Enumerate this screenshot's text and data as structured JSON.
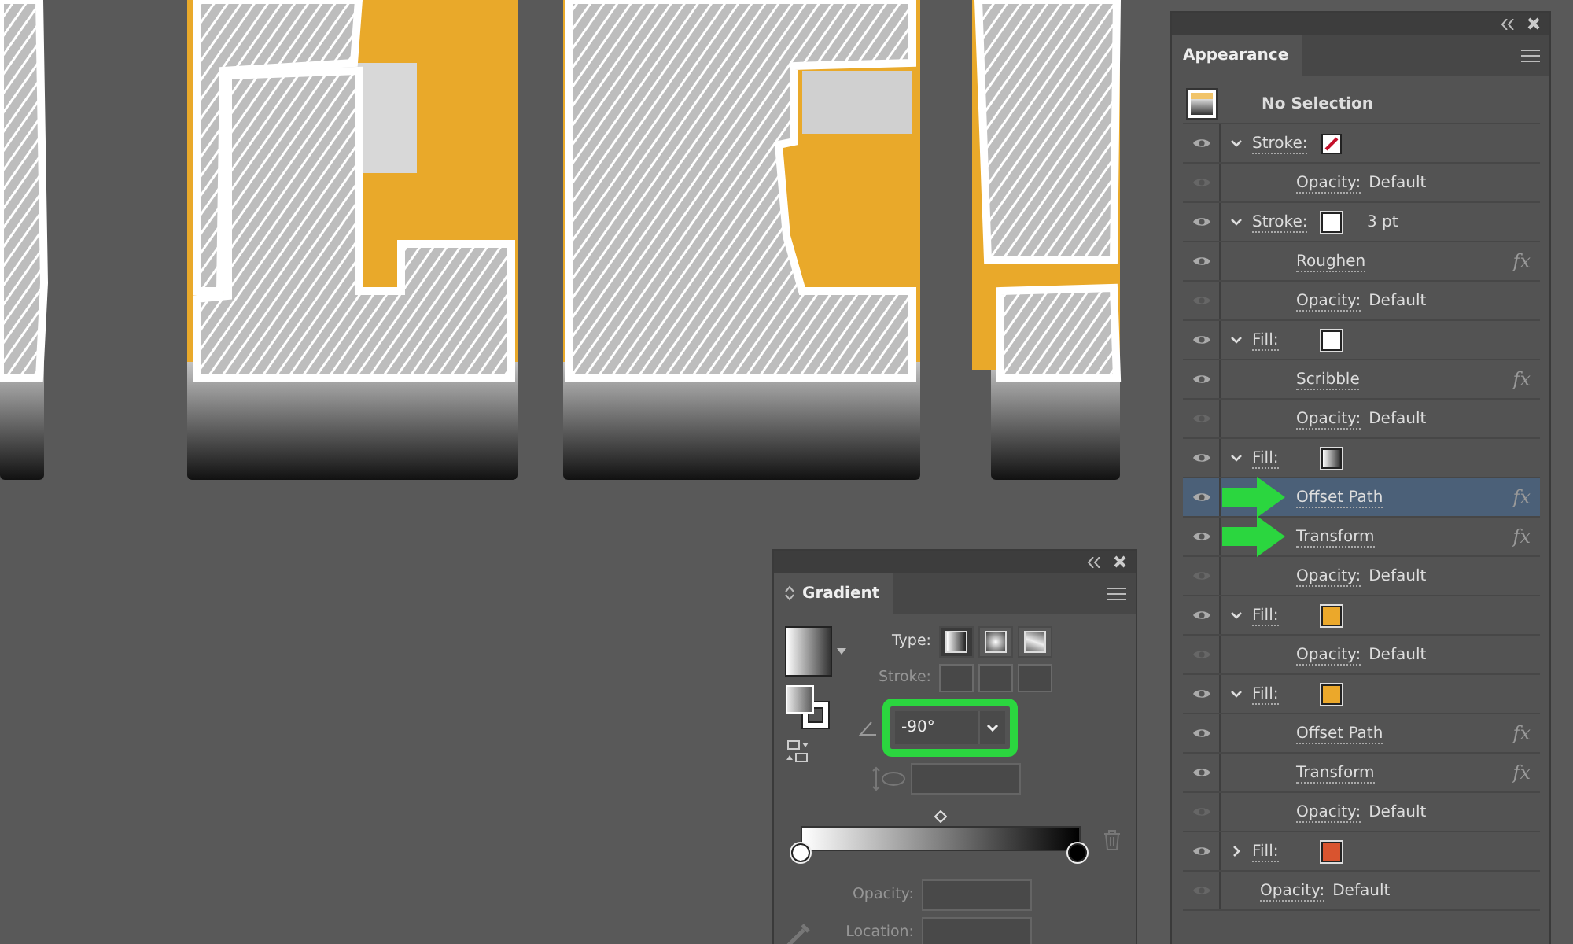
{
  "appearance": {
    "title": "Appearance",
    "header": "No Selection",
    "items": [
      {
        "kind": "stroke",
        "label": "Stroke:",
        "swatch": {
          "kind": "none"
        },
        "expanded": true,
        "children": [
          {
            "kind": "opacity",
            "label": "Opacity:",
            "value": "Default"
          }
        ]
      },
      {
        "kind": "stroke",
        "label": "Stroke:",
        "swatch": {
          "kind": "solid",
          "color": "#ffffff"
        },
        "value": "3 pt",
        "expanded": true,
        "children": [
          {
            "kind": "effect",
            "label": "Roughen",
            "badge": "fx",
            "selected": false,
            "arrow": false
          },
          {
            "kind": "opacity",
            "label": "Opacity:",
            "value": "Default"
          }
        ]
      },
      {
        "kind": "fill",
        "label": "Fill:",
        "swatch": {
          "kind": "solid",
          "color": "#ffffff"
        },
        "expanded": true,
        "children": [
          {
            "kind": "effect",
            "label": "Scribble",
            "badge": "fx",
            "selected": false,
            "arrow": false
          },
          {
            "kind": "opacity",
            "label": "Opacity:",
            "value": "Default"
          }
        ]
      },
      {
        "kind": "fill",
        "label": "Fill:",
        "swatch": {
          "kind": "gradient"
        },
        "expanded": true,
        "children": [
          {
            "kind": "effect",
            "label": "Offset Path",
            "badge": "fx",
            "selected": true,
            "arrow": true
          },
          {
            "kind": "effect",
            "label": "Transform",
            "badge": "fx",
            "selected": false,
            "arrow": true
          },
          {
            "kind": "opacity",
            "label": "Opacity:",
            "value": "Default"
          }
        ]
      },
      {
        "kind": "fill",
        "label": "Fill:",
        "swatch": {
          "kind": "solid",
          "color": "#eba82b"
        },
        "expanded": true,
        "children": [
          {
            "kind": "opacity",
            "label": "Opacity:",
            "value": "Default"
          }
        ]
      },
      {
        "kind": "fill",
        "label": "Fill:",
        "swatch": {
          "kind": "solid",
          "color": "#eba82b"
        },
        "expanded": true,
        "children": [
          {
            "kind": "effect",
            "label": "Offset Path",
            "badge": "fx",
            "selected": false,
            "arrow": false
          },
          {
            "kind": "effect",
            "label": "Transform",
            "badge": "fx",
            "selected": false,
            "arrow": false
          },
          {
            "kind": "opacity",
            "label": "Opacity:",
            "value": "Default"
          }
        ]
      },
      {
        "kind": "fill",
        "label": "Fill:",
        "swatch": {
          "kind": "solid",
          "color": "#d9542f"
        },
        "expanded": false
      },
      {
        "kind": "opacity",
        "label": "Opacity:",
        "value": "Default"
      }
    ]
  },
  "gradient": {
    "title": "Gradient",
    "type_label": "Type:",
    "types": [
      {
        "kind": "linear",
        "selected": true
      },
      {
        "kind": "radial",
        "selected": false
      },
      {
        "kind": "freeform",
        "selected": false
      }
    ],
    "stroke_label": "Stroke:",
    "angle": {
      "value": "-90°",
      "highlighted": true
    },
    "stops": [
      {
        "color": "#ffffff"
      },
      {
        "color": "#000000"
      }
    ],
    "opacity_label": "Opacity:",
    "location_label": "Location:"
  }
}
